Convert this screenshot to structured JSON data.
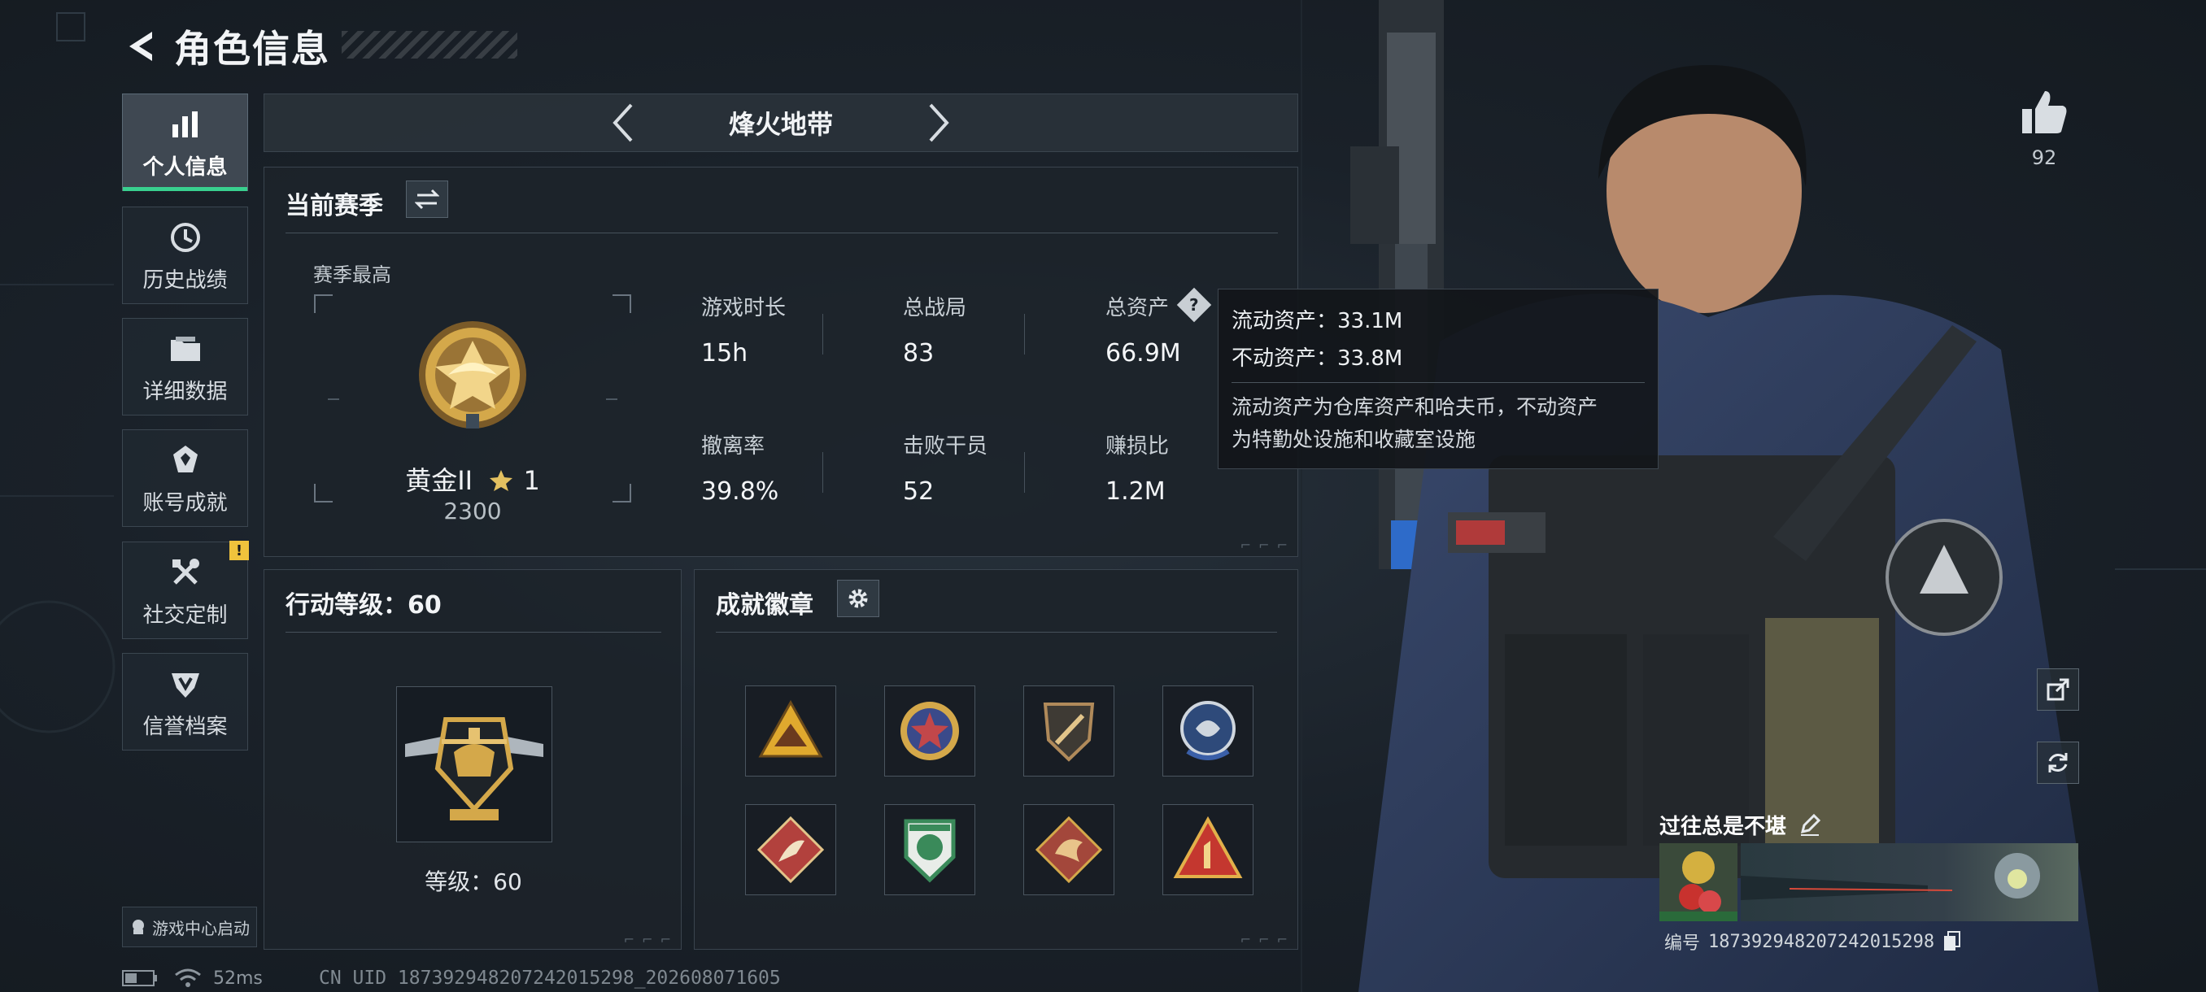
{
  "header": {
    "title": "角色信息"
  },
  "sidebar": {
    "items": [
      {
        "label": "个人信息",
        "icon": "bar-chart-icon",
        "active": true
      },
      {
        "label": "历史战绩",
        "icon": "history-icon"
      },
      {
        "label": "详细数据",
        "icon": "folder-icon"
      },
      {
        "label": "账号成就",
        "icon": "achievement-icon"
      },
      {
        "label": "社交定制",
        "icon": "tools-icon",
        "badge": "!"
      },
      {
        "label": "信誉档案",
        "icon": "shield-icon"
      }
    ],
    "game_center": "游戏中心启动"
  },
  "status_bar": {
    "ping": "52ms",
    "uid": "CN UID 187392948207242015298_202608071605"
  },
  "mode": {
    "title": "烽火地带"
  },
  "season": {
    "title": "当前赛季",
    "best_label": "赛季最高",
    "rank_name": "黄金II",
    "rank_stars": "1",
    "rank_score": "2300",
    "stats": [
      {
        "label": "游戏时长",
        "value": "15h"
      },
      {
        "label": "总战局",
        "value": "83"
      },
      {
        "label": "总资产",
        "value": "66.9M"
      },
      {
        "label": "撤离率",
        "value": "39.8%"
      },
      {
        "label": "击败干员",
        "value": "52"
      },
      {
        "label": "赚损比",
        "value": "1.2M"
      }
    ]
  },
  "tooltip": {
    "liquid": "流动资产：33.1M",
    "fixed": "不动资产：33.8M",
    "desc_line1": "流动资产为仓库资产和哈夫币，不动资产",
    "desc_line2": "为特勤处设施和收藏室设施"
  },
  "level": {
    "title": "行动等级：60",
    "text": "等级：60"
  },
  "achievements": {
    "title": "成就徽章",
    "badges": [
      {
        "icon": "triangle-mountain-badge-icon",
        "color": "#e0a92e"
      },
      {
        "icon": "star-medal-badge-icon",
        "color": "#c2474a"
      },
      {
        "icon": "shield-blade-badge-icon",
        "color": "#b08a5a"
      },
      {
        "icon": "blue-crest-badge-icon",
        "color": "#3a5fa8"
      },
      {
        "icon": "red-diamond-runner-badge-icon",
        "color": "#b2413d"
      },
      {
        "icon": "green-shield-badge-icon",
        "color": "#3a8a5a"
      },
      {
        "icon": "dragon-diamond-badge-icon",
        "color": "#a3473b"
      },
      {
        "icon": "number-one-triangle-badge-icon",
        "color": "#c4372f"
      }
    ]
  },
  "player": {
    "likes": "92",
    "name": "过往总是不堪",
    "id_label": "编号",
    "id_value": "187392948207242015298"
  },
  "colors": {
    "accent": "#39d08f",
    "gold": "#d4a84a",
    "warning": "#f0c33c"
  }
}
